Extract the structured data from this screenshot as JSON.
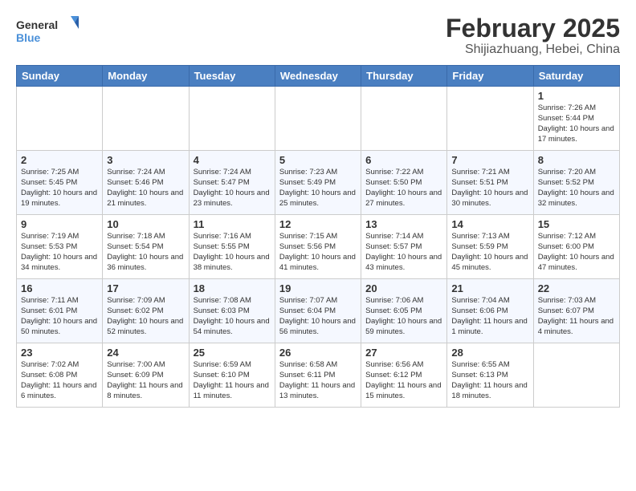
{
  "logo": {
    "line1": "General",
    "line2": "Blue"
  },
  "title": "February 2025",
  "location": "Shijiazhuang, Hebei, China",
  "days_of_week": [
    "Sunday",
    "Monday",
    "Tuesday",
    "Wednesday",
    "Thursday",
    "Friday",
    "Saturday"
  ],
  "weeks": [
    [
      {
        "day": "",
        "info": ""
      },
      {
        "day": "",
        "info": ""
      },
      {
        "day": "",
        "info": ""
      },
      {
        "day": "",
        "info": ""
      },
      {
        "day": "",
        "info": ""
      },
      {
        "day": "",
        "info": ""
      },
      {
        "day": "1",
        "info": "Sunrise: 7:26 AM\nSunset: 5:44 PM\nDaylight: 10 hours\nand 17 minutes."
      }
    ],
    [
      {
        "day": "2",
        "info": "Sunrise: 7:25 AM\nSunset: 5:45 PM\nDaylight: 10 hours\nand 19 minutes."
      },
      {
        "day": "3",
        "info": "Sunrise: 7:24 AM\nSunset: 5:46 PM\nDaylight: 10 hours\nand 21 minutes."
      },
      {
        "day": "4",
        "info": "Sunrise: 7:24 AM\nSunset: 5:47 PM\nDaylight: 10 hours\nand 23 minutes."
      },
      {
        "day": "5",
        "info": "Sunrise: 7:23 AM\nSunset: 5:49 PM\nDaylight: 10 hours\nand 25 minutes."
      },
      {
        "day": "6",
        "info": "Sunrise: 7:22 AM\nSunset: 5:50 PM\nDaylight: 10 hours\nand 27 minutes."
      },
      {
        "day": "7",
        "info": "Sunrise: 7:21 AM\nSunset: 5:51 PM\nDaylight: 10 hours\nand 30 minutes."
      },
      {
        "day": "8",
        "info": "Sunrise: 7:20 AM\nSunset: 5:52 PM\nDaylight: 10 hours\nand 32 minutes."
      }
    ],
    [
      {
        "day": "9",
        "info": "Sunrise: 7:19 AM\nSunset: 5:53 PM\nDaylight: 10 hours\nand 34 minutes."
      },
      {
        "day": "10",
        "info": "Sunrise: 7:18 AM\nSunset: 5:54 PM\nDaylight: 10 hours\nand 36 minutes."
      },
      {
        "day": "11",
        "info": "Sunrise: 7:16 AM\nSunset: 5:55 PM\nDaylight: 10 hours\nand 38 minutes."
      },
      {
        "day": "12",
        "info": "Sunrise: 7:15 AM\nSunset: 5:56 PM\nDaylight: 10 hours\nand 41 minutes."
      },
      {
        "day": "13",
        "info": "Sunrise: 7:14 AM\nSunset: 5:57 PM\nDaylight: 10 hours\nand 43 minutes."
      },
      {
        "day": "14",
        "info": "Sunrise: 7:13 AM\nSunset: 5:59 PM\nDaylight: 10 hours\nand 45 minutes."
      },
      {
        "day": "15",
        "info": "Sunrise: 7:12 AM\nSunset: 6:00 PM\nDaylight: 10 hours\nand 47 minutes."
      }
    ],
    [
      {
        "day": "16",
        "info": "Sunrise: 7:11 AM\nSunset: 6:01 PM\nDaylight: 10 hours\nand 50 minutes."
      },
      {
        "day": "17",
        "info": "Sunrise: 7:09 AM\nSunset: 6:02 PM\nDaylight: 10 hours\nand 52 minutes."
      },
      {
        "day": "18",
        "info": "Sunrise: 7:08 AM\nSunset: 6:03 PM\nDaylight: 10 hours\nand 54 minutes."
      },
      {
        "day": "19",
        "info": "Sunrise: 7:07 AM\nSunset: 6:04 PM\nDaylight: 10 hours\nand 56 minutes."
      },
      {
        "day": "20",
        "info": "Sunrise: 7:06 AM\nSunset: 6:05 PM\nDaylight: 10 hours\nand 59 minutes."
      },
      {
        "day": "21",
        "info": "Sunrise: 7:04 AM\nSunset: 6:06 PM\nDaylight: 11 hours\nand 1 minute."
      },
      {
        "day": "22",
        "info": "Sunrise: 7:03 AM\nSunset: 6:07 PM\nDaylight: 11 hours\nand 4 minutes."
      }
    ],
    [
      {
        "day": "23",
        "info": "Sunrise: 7:02 AM\nSunset: 6:08 PM\nDaylight: 11 hours\nand 6 minutes."
      },
      {
        "day": "24",
        "info": "Sunrise: 7:00 AM\nSunset: 6:09 PM\nDaylight: 11 hours\nand 8 minutes."
      },
      {
        "day": "25",
        "info": "Sunrise: 6:59 AM\nSunset: 6:10 PM\nDaylight: 11 hours\nand 11 minutes."
      },
      {
        "day": "26",
        "info": "Sunrise: 6:58 AM\nSunset: 6:11 PM\nDaylight: 11 hours\nand 13 minutes."
      },
      {
        "day": "27",
        "info": "Sunrise: 6:56 AM\nSunset: 6:12 PM\nDaylight: 11 hours\nand 15 minutes."
      },
      {
        "day": "28",
        "info": "Sunrise: 6:55 AM\nSunset: 6:13 PM\nDaylight: 11 hours\nand 18 minutes."
      },
      {
        "day": "",
        "info": ""
      }
    ]
  ]
}
